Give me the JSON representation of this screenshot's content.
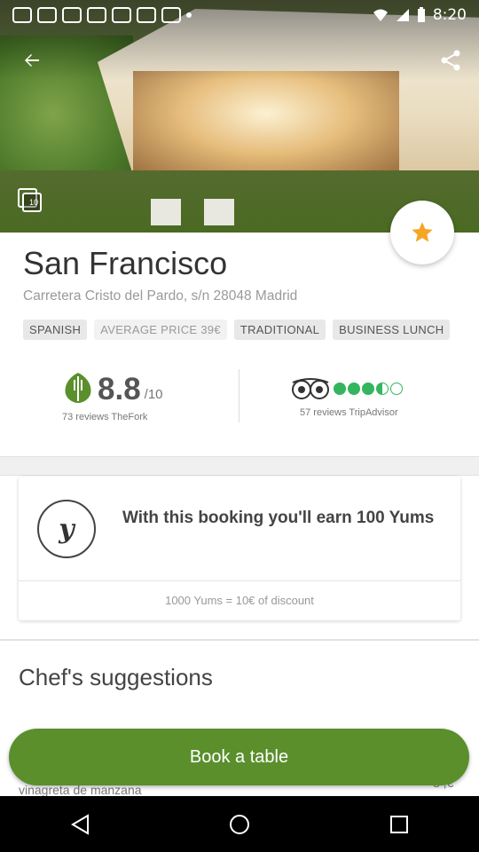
{
  "status_bar": {
    "time": "8:20",
    "notification_icons": [
      "shield-icon",
      "image-icon",
      "b-icon",
      "image-icon",
      "esc-icon",
      "pet-icon",
      "pet-icon",
      "dot-icon"
    ]
  },
  "hero": {
    "gallery_count": "10"
  },
  "restaurant": {
    "name": "San Francisco",
    "address": "Carretera Cristo del Pardo, s/n 28048 Madrid",
    "tags": [
      "SPANISH",
      "AVERAGE PRICE 39€",
      "TRADITIONAL",
      "BUSINESS LUNCH"
    ]
  },
  "ratings": {
    "thefork": {
      "score": "8.8",
      "out_of": "/10",
      "reviews": "73 reviews TheFork"
    },
    "tripadvisor": {
      "bubbles": 3.5,
      "reviews": "57 reviews TripAdvisor"
    }
  },
  "yums": {
    "logo": "y",
    "message": "With this booking you'll earn 100 Yums",
    "note": "1000 Yums = 10€ of discount"
  },
  "chef": {
    "title": "Chef's suggestions",
    "dish_line": "vinagreta de manzana",
    "price": "8 ,€"
  },
  "actions": {
    "book_label": "Book a table"
  },
  "colors": {
    "accent_green": "#5a8f2c",
    "tripadvisor_green": "#34b55f",
    "star_orange": "#f5a623"
  }
}
